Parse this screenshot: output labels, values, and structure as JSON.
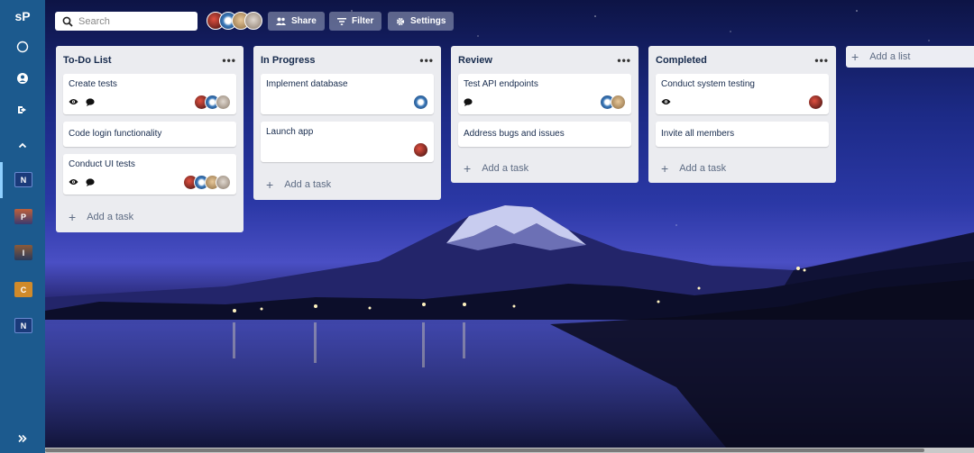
{
  "sidebar": {
    "logo": "sP",
    "boards": [
      {
        "letter": "N",
        "color": "#1a3a7a"
      },
      {
        "letter": "P",
        "color": "#c0603a"
      },
      {
        "letter": "I",
        "color": "#8a5a3a"
      },
      {
        "letter": "C",
        "color": "#d08a2a"
      },
      {
        "letter": "N",
        "color": "#1a3a7a"
      }
    ]
  },
  "topbar": {
    "search_placeholder": "Search",
    "share_label": "Share",
    "filter_label": "Filter",
    "settings_label": "Settings"
  },
  "lists": [
    {
      "title": "To-Do List",
      "cards": [
        {
          "title": "Create tests"
        },
        {
          "title": "Code login functionality"
        },
        {
          "title": "Conduct UI tests"
        }
      ],
      "add_label": "Add a task"
    },
    {
      "title": "In Progress",
      "cards": [
        {
          "title": "Implement database"
        },
        {
          "title": "Launch app"
        }
      ],
      "add_label": "Add a task"
    },
    {
      "title": "Review",
      "cards": [
        {
          "title": "Test API endpoints"
        },
        {
          "title": "Address bugs and issues"
        }
      ],
      "add_label": "Add a task"
    },
    {
      "title": "Completed",
      "cards": [
        {
          "title": "Conduct system testing"
        },
        {
          "title": "Invite all members"
        }
      ],
      "add_label": "Add a task"
    }
  ],
  "add_list_label": "Add a list",
  "menu_dots": "•••",
  "plus_glyph": "+",
  "colors": {
    "sidebar": "#1c5a8e",
    "list_bg": "#ebecf0",
    "avatar_1": "#c0392b",
    "avatar_2": "#3a78b8",
    "avatar_3": "#c8a070",
    "avatar_4": "#9a8a7a"
  }
}
